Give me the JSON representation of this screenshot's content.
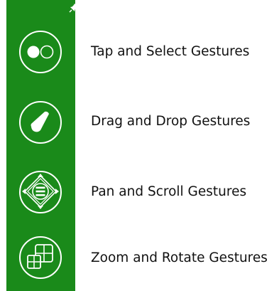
{
  "colors": {
    "toolbar_bg": "#1a8a1a",
    "icon_stroke": "#ffffff",
    "label_text": "#111111"
  },
  "toolbar": {
    "pin_icon": "pin-icon",
    "items": [
      {
        "label": "Tap and Select Gestures",
        "icon": "tap-select-icon"
      },
      {
        "label": "Drag and Drop Gestures",
        "icon": "drag-drop-icon"
      },
      {
        "label": "Pan and Scroll Gestures",
        "icon": "pan-scroll-icon"
      },
      {
        "label": "Zoom and Rotate Gestures",
        "icon": "zoom-rotate-icon"
      }
    ]
  }
}
